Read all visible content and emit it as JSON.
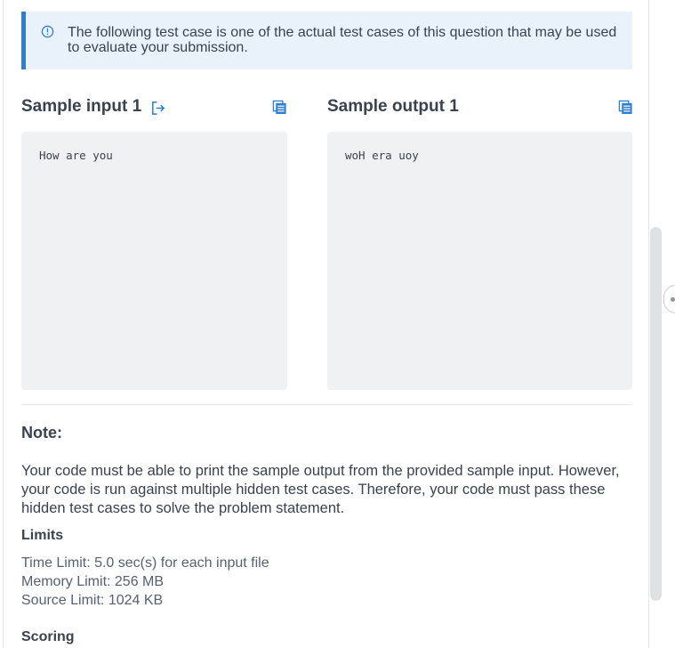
{
  "notice": {
    "text": "The following test case is one of the actual test cases of this question that may be used to evaluate your submission."
  },
  "sample_input": {
    "title": "Sample input 1",
    "content": "How are you"
  },
  "sample_output": {
    "title": "Sample output 1",
    "content": "woH era uoy"
  },
  "note": {
    "title": "Note:",
    "body": "Your code must be able to print the sample output from the provided sample input. However, your code is run against multiple hidden test cases. Therefore, your code must pass these hidden test cases to solve the problem statement."
  },
  "limits": {
    "title": "Limits",
    "time": "Time Limit: 5.0 sec(s) for each input file",
    "memory": "Memory Limit: 256 MB",
    "source": "Source Limit: 1024 KB"
  },
  "scoring": {
    "title": "Scoring"
  },
  "colors": {
    "accent": "#2f7fce",
    "info_bg": "#e9f2fb",
    "code_bg": "#f0f1f3",
    "text": "#39424e"
  },
  "icons": {
    "info": "info-circle-icon",
    "export": "export-icon",
    "copy": "copy-icon"
  }
}
